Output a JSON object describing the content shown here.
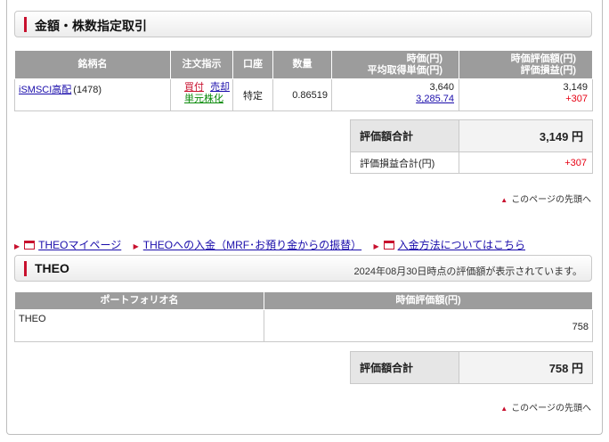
{
  "section1": {
    "title": "金額・株数指定取引"
  },
  "holdings_table": {
    "headers": {
      "name": "銘柄名",
      "order": "注文指示",
      "account": "口座",
      "quantity": "数量",
      "price_line1": "時価(円)",
      "price_line2": "平均取得単価(円)",
      "value_line1": "時価評価額(円)",
      "value_line2": "評価損益(円)"
    },
    "row": {
      "name": "iSMSCI高配",
      "code": "(1478)",
      "buy": "買付",
      "sell": "売却",
      "convert": "単元株化",
      "account": "特定",
      "quantity": "0.86519",
      "market_price": "3,640",
      "avg_price": "3,285.74",
      "market_value": "3,149",
      "gain": "+307"
    }
  },
  "summary1": {
    "total_label": "評価額合計",
    "total_value": "3,149 円",
    "gain_label": "評価損益合計(円)",
    "gain_value": "+307"
  },
  "page_top_label": "このページの先頭へ",
  "links": {
    "theo_mypage": "THEOマイページ",
    "theo_deposit": "THEOへの入金（MRF･お預り金からの振替）",
    "deposit_methods": "入金方法についてはこちら"
  },
  "section2": {
    "title": "THEO",
    "note": "2024年08月30日時点の評価額が表示されています。"
  },
  "portfolio_table": {
    "headers": {
      "name": "ポートフォリオ名",
      "value": "時価評価額(円)"
    },
    "row": {
      "name": "THEO",
      "value": "758"
    }
  },
  "summary2": {
    "total_label": "評価額合計",
    "total_value": "758 円"
  },
  "colors": {
    "accent_red": "#c8102e",
    "header_gray": "#9c9c9c",
    "link_blue": "#1a0dab",
    "gain_red": "#e60012"
  }
}
